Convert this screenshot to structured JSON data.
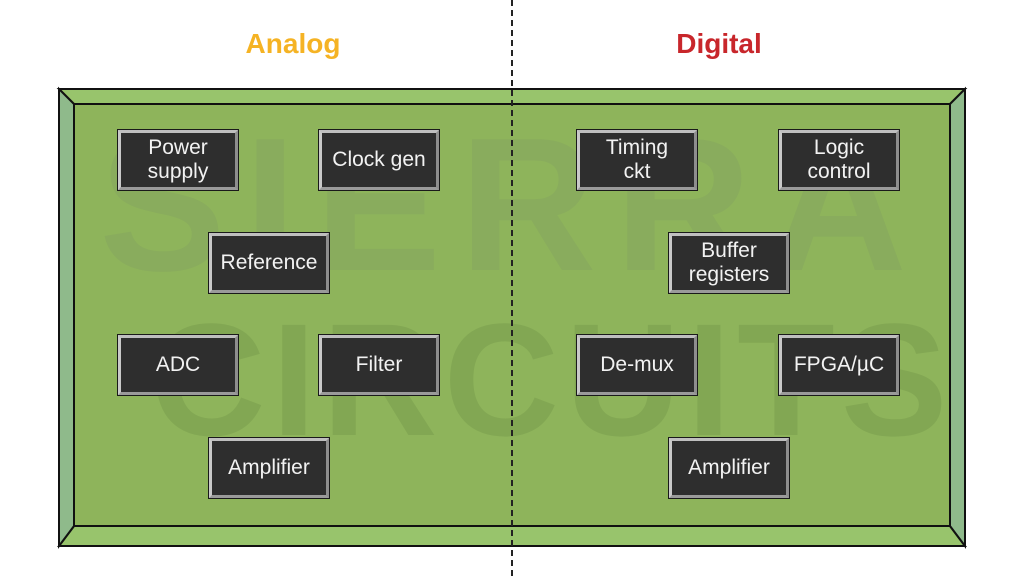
{
  "colors": {
    "analog_heading": "#f5b324",
    "digital_heading": "#c8262b",
    "board_fill": "#8eb45b",
    "board_bevel_top": "#98c46c",
    "board_bevel_side": "#8fba8b",
    "chip_fill": "#2e2e2e",
    "chip_text": "#f2f2f2"
  },
  "headings": {
    "analog": "Analog",
    "digital": "Digital"
  },
  "watermark": {
    "line1": "SIERRA",
    "line2": "CIRCUITS"
  },
  "analog_blocks": [
    {
      "id": "power-supply",
      "lines": [
        "Power",
        "supply"
      ]
    },
    {
      "id": "clock-gen",
      "lines": [
        "Clock gen"
      ]
    },
    {
      "id": "reference",
      "lines": [
        "Reference"
      ]
    },
    {
      "id": "adc",
      "lines": [
        "ADC"
      ]
    },
    {
      "id": "filter",
      "lines": [
        "Filter"
      ]
    },
    {
      "id": "amplifier",
      "lines": [
        "Amplifier"
      ]
    }
  ],
  "digital_blocks": [
    {
      "id": "timing-ckt",
      "lines": [
        "Timing",
        "ckt"
      ]
    },
    {
      "id": "logic-control",
      "lines": [
        "Logic",
        "control"
      ]
    },
    {
      "id": "buffer-registers",
      "lines": [
        "Buffer",
        "registers"
      ]
    },
    {
      "id": "de-mux",
      "lines": [
        "De-mux"
      ]
    },
    {
      "id": "fpga-uc",
      "lines": [
        "FPGA/µC"
      ]
    },
    {
      "id": "amplifier",
      "lines": [
        "Amplifier"
      ]
    }
  ]
}
